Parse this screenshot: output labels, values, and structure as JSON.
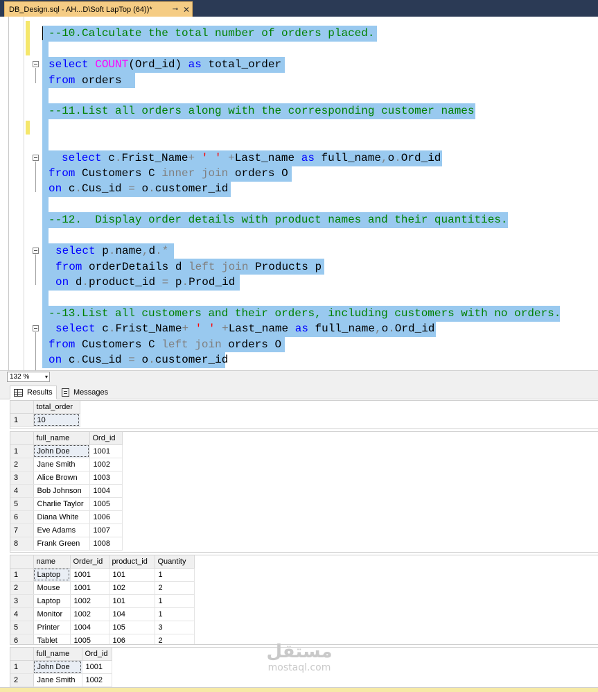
{
  "tab": {
    "title": "DB_Design.sql - AH...D\\Soft LapTop (64))*",
    "pin": "⊸",
    "close": "✕"
  },
  "editor": {
    "lines": {
      "l1": "--10.Calculate the total number of orders placed.",
      "l2_kw1": "select",
      "l2_fn": "COUNT",
      "l2_rest": "(Ord_id)",
      "l2_kw2": "as",
      "l2_tail": "total_order",
      "l3_kw": "from",
      "l3_rest": "orders",
      "l4": "--11.List all orders along with the corresponding customer names",
      "l5_kw": "select",
      "l5_a": "c",
      "l5_b": ".",
      "l5_c": "Frist_Name",
      "l5_d": "+",
      "l5_e": "' '",
      "l5_f": "+",
      "l5_g": "Last_name",
      "l5_kw2": "as",
      "l5_h": "full_name",
      "l5_i": ",",
      "l5_j": "o",
      "l5_k": ".",
      "l5_l": "Ord_id",
      "l6_kw": "from",
      "l6_a": "Customers C",
      "l6_b": "inner join",
      "l6_c": "orders O",
      "l7_kw": "on",
      "l7_a": "c",
      "l7_b": ".",
      "l7_c": "Cus_id",
      "l7_d": "=",
      "l7_e": "o",
      "l7_f": ".",
      "l7_g": "customer_id",
      "l8": "--12.  Display order details with product names and their quantities.",
      "l9_kw": "select",
      "l9_a": "p",
      "l9_b": ".",
      "l9_c": "name",
      "l9_d": ",",
      "l9_e": "d",
      "l9_f": ".*",
      "l10_kw": "from",
      "l10_a": "orderDetails d",
      "l10_b": "left join",
      "l10_c": "Products p",
      "l11_kw": "on",
      "l11_a": "d",
      "l11_b": ".",
      "l11_c": "product_id",
      "l11_d": "=",
      "l11_e": "p",
      "l11_f": ".",
      "l11_g": "Prod_id",
      "l12": "--13.List all customers and their orders, including customers with no orders.",
      "l13_kw": "select",
      "l13_a": "c",
      "l13_b": ".",
      "l13_c": "Frist_Name",
      "l13_d": "+",
      "l13_e": "' '",
      "l13_f": "+",
      "l13_g": "Last_name",
      "l13_kw2": "as",
      "l13_h": "full_name",
      "l13_i": ",",
      "l13_j": "o",
      "l13_k": ".",
      "l13_l": "Ord_id",
      "l14_kw": "from",
      "l14_a": "Customers C",
      "l14_b": "left join",
      "l14_c": "orders O",
      "l15_kw": "on",
      "l15_a": "c",
      "l15_b": ".",
      "l15_c": "Cus_id",
      "l15_d": "=",
      "l15_e": "o",
      "l15_f": ".",
      "l15_g": "customer_id"
    }
  },
  "zoom": {
    "value": "132 %",
    "arrow": "▾"
  },
  "results_tabs": {
    "results": "Results",
    "messages": "Messages"
  },
  "grid1": {
    "headers": [
      "total_order"
    ],
    "rows": [
      [
        "1",
        "10"
      ]
    ]
  },
  "grid2": {
    "headers": [
      "full_name",
      "Ord_id"
    ],
    "rows": [
      [
        "1",
        "John Doe",
        "1001"
      ],
      [
        "2",
        "Jane Smith",
        "1002"
      ],
      [
        "3",
        "Alice Brown",
        "1003"
      ],
      [
        "4",
        "Bob Johnson",
        "1004"
      ],
      [
        "5",
        "Charlie Taylor",
        "1005"
      ],
      [
        "6",
        "Diana White",
        "1006"
      ],
      [
        "7",
        "Eve Adams",
        "1007"
      ],
      [
        "8",
        "Frank Green",
        "1008"
      ]
    ]
  },
  "grid3": {
    "headers": [
      "name",
      "Order_id",
      "product_id",
      "Quantity"
    ],
    "rows": [
      [
        "1",
        "Laptop",
        "1001",
        "101",
        "1"
      ],
      [
        "2",
        "Mouse",
        "1001",
        "102",
        "2"
      ],
      [
        "3",
        "Laptop",
        "1002",
        "101",
        "1"
      ],
      [
        "4",
        "Monitor",
        "1002",
        "104",
        "1"
      ],
      [
        "5",
        "Printer",
        "1004",
        "105",
        "3"
      ],
      [
        "6",
        "Tablet",
        "1005",
        "106",
        "2"
      ]
    ]
  },
  "grid4": {
    "headers": [
      "full_name",
      "Ord_id"
    ],
    "rows": [
      [
        "1",
        "John Doe",
        "1001"
      ],
      [
        "2",
        "Jane Smith",
        "1002"
      ]
    ]
  },
  "watermark": {
    "arabic": "مستقل",
    "latin": "mostaql.com"
  }
}
